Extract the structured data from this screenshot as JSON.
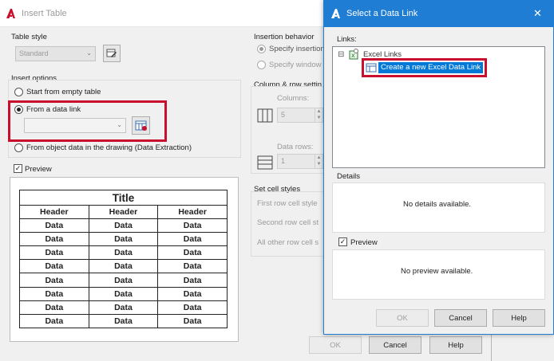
{
  "insert_table": {
    "title": "Insert Table",
    "table_style": {
      "label": "Table style",
      "value": "Standard"
    },
    "insert_options": {
      "label": "Insert options",
      "option_empty": "Start from empty table",
      "option_data_link": "From a data link",
      "option_object_data": "From object data in the drawing (Data Extraction)"
    },
    "preview_label": "Preview",
    "preview_table": {
      "title": "Title",
      "headers": [
        "Header",
        "Header",
        "Header"
      ],
      "cell": "Data"
    },
    "insertion_behavior": {
      "label": "Insertion behavior",
      "option_point": "Specify insertion",
      "option_window": "Specify window"
    },
    "column_row": {
      "label": "Column & row settin",
      "columns_label": "Columns:",
      "columns_value": "5",
      "data_rows_label": "Data rows:",
      "data_rows_value": "1"
    },
    "cell_styles": {
      "label": "Set cell styles",
      "first_row": "First row cell style",
      "second_row": "Second row cell st",
      "all_other": "All other row cell s"
    },
    "buttons": {
      "ok": "OK",
      "cancel": "Cancel",
      "help": "Help"
    }
  },
  "data_link": {
    "title": "Select a Data Link",
    "close_glyph": "✕",
    "links_label": "Links:",
    "tree_root": "Excel Links",
    "tree_expander": "⊟",
    "tree_child": "Create a new Excel Data Link",
    "details_label": "Details",
    "details_text": "No details available.",
    "preview_label": "Preview",
    "preview_text": "No preview available.",
    "buttons": {
      "ok": "OK",
      "cancel": "Cancel",
      "help": "Help"
    }
  },
  "colors": {
    "accent_red": "#c8102e",
    "selection_blue": "#0078d7",
    "title_bar_blue": "#1f7dd4"
  }
}
